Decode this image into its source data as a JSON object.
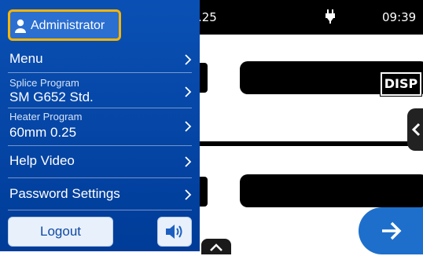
{
  "status_bar": {
    "partial_value": ".25",
    "time": "09:39"
  },
  "camera_view": {
    "disp_label": "DISP"
  },
  "drawer": {
    "user_role": "Administrator",
    "menu_label": "Menu",
    "splice_program": {
      "title": "Splice Program",
      "value": "SM G652 Std."
    },
    "heater_program": {
      "title": "Heater Program",
      "value": "60mm 0.25"
    },
    "help_video_label": "Help Video",
    "password_settings_label": "Password Settings",
    "logout_label": "Logout"
  },
  "icons": {
    "user": "user-icon",
    "chevron": "chevron-right-icon",
    "speaker": "speaker-icon",
    "plug": "plug-icon",
    "next": "arrow-right-icon",
    "collapse": "chevron-left-icon",
    "expand": "chevron-up-icon"
  },
  "colors": {
    "drawer_bg": "#0a50b4",
    "highlight_border": "#f7b500",
    "next_button": "#1d6fcb"
  }
}
